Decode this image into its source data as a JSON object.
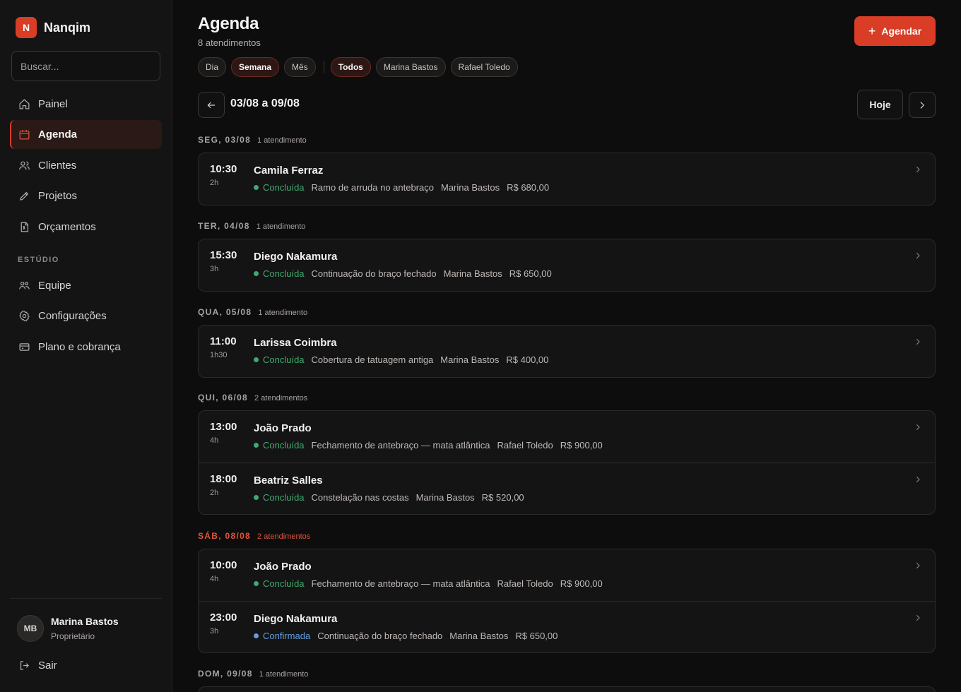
{
  "brand": {
    "logo_letter": "N",
    "name": "Nanqim",
    "accent": "#d93d26"
  },
  "search": {
    "placeholder": "Buscar..."
  },
  "nav": {
    "items": [
      {
        "label": "Painel",
        "icon": "home-icon"
      },
      {
        "label": "Agenda",
        "icon": "calendar-icon",
        "active": true
      },
      {
        "label": "Clientes",
        "icon": "users-icon"
      },
      {
        "label": "Projetos",
        "icon": "pencil-icon"
      },
      {
        "label": "Orçamentos",
        "icon": "invoice-icon"
      }
    ],
    "section_label": "ESTÚDIO",
    "studio_items": [
      {
        "label": "Equipe",
        "icon": "team-icon"
      },
      {
        "label": "Configurações",
        "icon": "gear-icon"
      },
      {
        "label": "Plano e cobrança",
        "icon": "credit-card-icon"
      }
    ]
  },
  "user": {
    "initials": "MB",
    "name": "Marina Bastos",
    "role": "Proprietário"
  },
  "logout": {
    "label": "Sair"
  },
  "header": {
    "title": "Agenda",
    "subtitle": "8 atendimentos",
    "primary_button": "Agendar",
    "primary_button_icon": "+"
  },
  "filters": {
    "view": [
      "Dia",
      "Semana",
      "Mês"
    ],
    "view_selected": "Semana",
    "artists": [
      "Todos",
      "Marina Bastos",
      "Rafael Toledo"
    ],
    "artist_selected": "Todos"
  },
  "week": {
    "range": "03/08 a 09/08",
    "today_label": "Hoje"
  },
  "status_colors": {
    "Concluída": "#3faa6e",
    "Confirmada": "#5f9fe0"
  },
  "days": [
    {
      "label": "SEG, 03/08",
      "count": "1 atendimento",
      "appointments": [
        {
          "time": "10:30",
          "duration": "2h",
          "client": "Camila Ferraz",
          "status": "Concluída",
          "description": "Ramo de arruda no antebraço",
          "artist": "Marina Bastos",
          "price": "R$ 680,00"
        }
      ]
    },
    {
      "label": "TER, 04/08",
      "count": "1 atendimento",
      "appointments": [
        {
          "time": "15:30",
          "duration": "3h",
          "client": "Diego Nakamura",
          "status": "Concluída",
          "description": "Continuação do braço fechado",
          "artist": "Marina Bastos",
          "price": "R$ 650,00"
        }
      ]
    },
    {
      "label": "QUA, 05/08",
      "count": "1 atendimento",
      "appointments": [
        {
          "time": "11:00",
          "duration": "1h30",
          "client": "Larissa Coimbra",
          "status": "Concluída",
          "description": "Cobertura de tatuagem antiga",
          "artist": "Marina Bastos",
          "price": "R$ 400,00"
        }
      ]
    },
    {
      "label": "QUI, 06/08",
      "count": "2 atendimentos",
      "appointments": [
        {
          "time": "13:00",
          "duration": "4h",
          "client": "João Prado",
          "status": "Concluída",
          "description": "Fechamento de antebraço — mata atlântica",
          "artist": "Rafael Toledo",
          "price": "R$ 900,00"
        },
        {
          "time": "18:00",
          "duration": "2h",
          "client": "Beatriz Salles",
          "status": "Concluída",
          "description": "Constelação nas costas",
          "artist": "Marina Bastos",
          "price": "R$ 520,00"
        }
      ]
    },
    {
      "label": "SÁB, 08/08",
      "count": "2 atendimentos",
      "today": true,
      "appointments": [
        {
          "time": "10:00",
          "duration": "4h",
          "client": "João Prado",
          "status": "Concluída",
          "description": "Fechamento de antebraço — mata atlântica",
          "artist": "Rafael Toledo",
          "price": "R$ 900,00"
        },
        {
          "time": "23:00",
          "duration": "3h",
          "client": "Diego Nakamura",
          "status": "Confirmada",
          "description": "Continuação do braço fechado",
          "artist": "Marina Bastos",
          "price": "R$ 650,00"
        }
      ]
    },
    {
      "label": "DOM, 09/08",
      "count": "1 atendimento",
      "appointments": []
    }
  ]
}
